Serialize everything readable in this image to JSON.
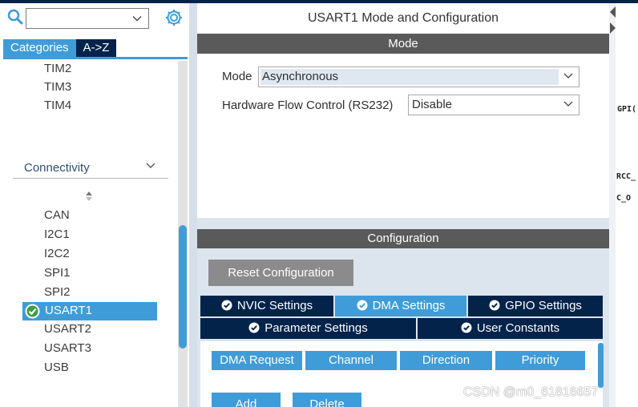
{
  "search": {
    "value": "",
    "placeholder": ""
  },
  "categories_tabs": {
    "categories": "Categories",
    "az": "A->Z"
  },
  "tree": {
    "timers_tail": [
      "TIM2",
      "TIM3",
      "TIM4"
    ],
    "connectivity_label": "Connectivity",
    "connectivity_items": [
      "CAN",
      "I2C1",
      "I2C2",
      "SPI1",
      "SPI2",
      "USART1",
      "USART2",
      "USART3",
      "USB"
    ],
    "selected": "USART1"
  },
  "panel": {
    "title": "USART1 Mode and Configuration",
    "mode_header": "Mode",
    "mode_label": "Mode",
    "mode_value": "Asynchronous",
    "flow_label": "Hardware Flow Control (RS232)",
    "flow_value": "Disable",
    "config_header": "Configuration",
    "reset_button": "Reset Configuration"
  },
  "config_tabs": {
    "row1": [
      "NVIC Settings",
      "DMA Settings",
      "GPIO Settings"
    ],
    "row2": [
      "Parameter Settings",
      "User Constants"
    ],
    "active": "DMA Settings"
  },
  "dma_table": {
    "columns": [
      "DMA Request",
      "Channel",
      "Direction",
      "Priority"
    ],
    "buttons": [
      "Add",
      "Delete"
    ]
  },
  "pinout_fragments": [
    "GPI(",
    "RCC_",
    "C_O"
  ],
  "watermark": "CSDN @m0_61816657",
  "colors": {
    "accent": "#3f9cd9",
    "navy": "#03234b",
    "header_grey": "#5a5a5a",
    "disabled_grey": "#8b8b8b",
    "panel_bg": "#dce5ee"
  }
}
